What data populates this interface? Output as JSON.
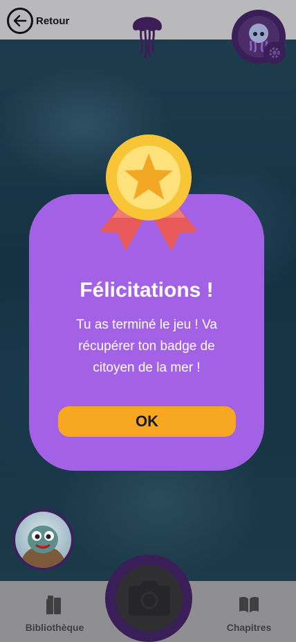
{
  "header": {
    "back_label": "Retour",
    "logo_icon": "jellyfish-icon",
    "profile_icon": "jellyfish-avatar-icon",
    "settings_icon": "gear-icon"
  },
  "modal": {
    "title": "Félicitations !",
    "message": "Tu as terminé le jeu ! Va récupérer ton badge de citoyen de la mer !",
    "ok_label": "OK",
    "medal_icon": "medal-star-icon"
  },
  "nav": {
    "library_label": "Bibliothèque",
    "library_icon": "books-icon",
    "chapters_label": "Chapitres",
    "chapters_icon": "open-book-icon",
    "camera_icon": "camera-icon"
  },
  "colors": {
    "modal_bg": "#a362e6",
    "button_bg": "#f8a722",
    "accent_dark_purple": "#3a1e57"
  }
}
